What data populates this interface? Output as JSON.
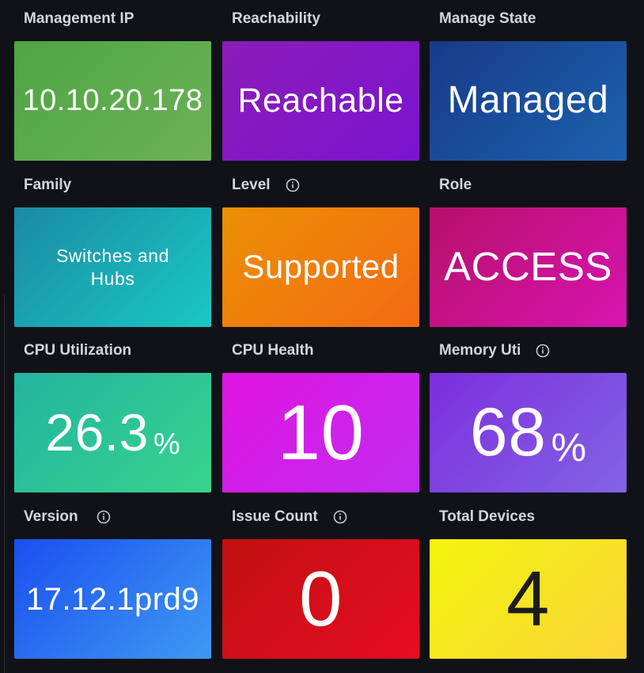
{
  "panels": [
    {
      "title": "Management IP",
      "value": "10.10.20.178",
      "unit": "",
      "info": false,
      "color": "#5bab4d"
    },
    {
      "title": "Reachability",
      "value": "Reachable",
      "unit": "",
      "info": false,
      "color": "#8418c4"
    },
    {
      "title": "Manage State",
      "value": "Managed",
      "unit": "",
      "info": false,
      "color": "#1a4e9c"
    },
    {
      "title": "Family",
      "value": "Switches and Hubs",
      "unit": "",
      "info": false,
      "color": "#1aa9b4"
    },
    {
      "title": "Level",
      "value": "Supported",
      "unit": "",
      "info": true,
      "color": "#f07d0c"
    },
    {
      "title": "Role",
      "value": "ACCESS",
      "unit": "",
      "info": false,
      "color": "#c8128e"
    },
    {
      "title": "CPU Utilization",
      "value": "26.3",
      "unit": "%",
      "info": false,
      "color": "#2cc496"
    },
    {
      "title": "CPU Health",
      "value": "10",
      "unit": "",
      "info": false,
      "color": "#d020e9"
    },
    {
      "title": "Memory Uti",
      "value": "68",
      "unit": "%",
      "info": true,
      "color": "#7f49e1"
    },
    {
      "title": "Version",
      "value": "17.12.1prd9",
      "unit": "",
      "info": true,
      "color": "#2c74f1"
    },
    {
      "title": "Issue Count",
      "value": "0",
      "unit": "",
      "info": true,
      "color": "#d40f1a"
    },
    {
      "title": "Total Devices",
      "value": "4",
      "unit": "",
      "info": false,
      "color": "#f8e423"
    }
  ],
  "icons": {
    "info": "info-circle-icon"
  }
}
